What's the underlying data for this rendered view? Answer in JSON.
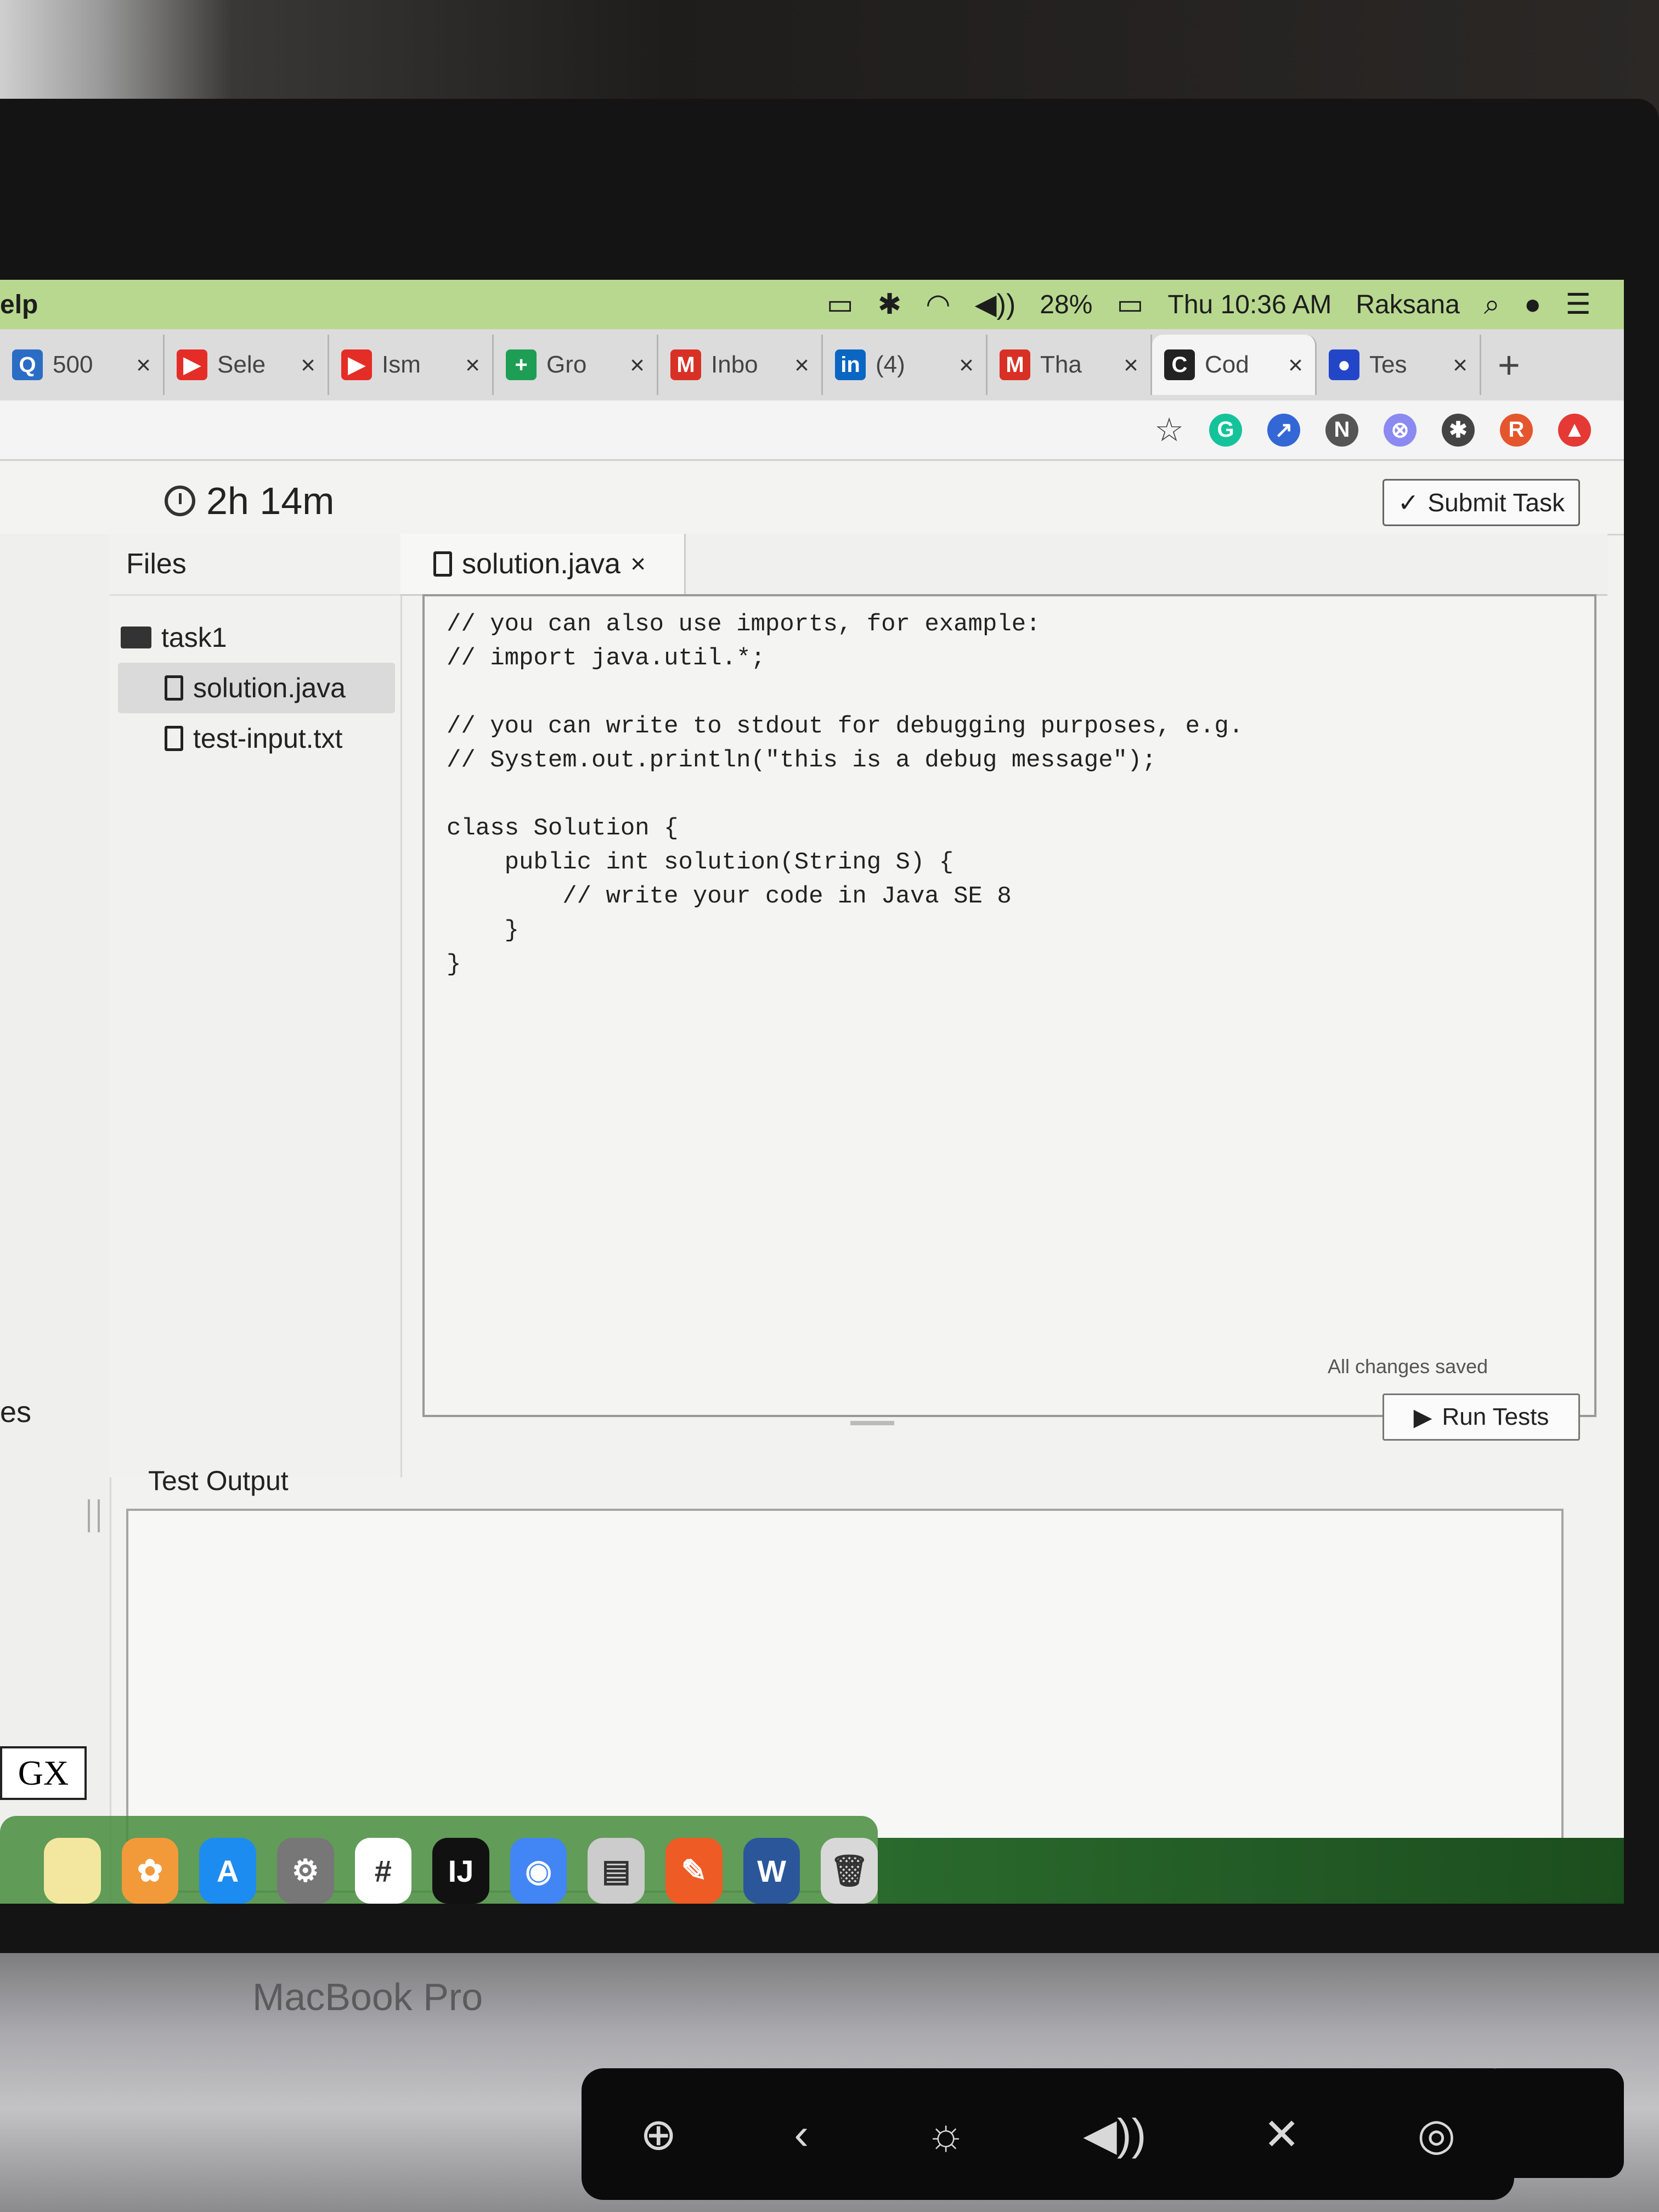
{
  "menubar": {
    "app_menu": "elp",
    "battery": "28%",
    "datetime": "Thu 10:36 AM",
    "user": "Raksana"
  },
  "tabs": [
    {
      "title": "500",
      "icon": "quora-icon",
      "color": "#2b6dc4",
      "glyph": "Q"
    },
    {
      "title": "Sele",
      "icon": "youtube-icon",
      "color": "#e52d27",
      "glyph": "▶"
    },
    {
      "title": "Ism",
      "icon": "youtube-icon",
      "color": "#e52d27",
      "glyph": "▶"
    },
    {
      "title": "Gro",
      "icon": "google-sheets-icon",
      "color": "#1e9e55",
      "glyph": "+"
    },
    {
      "title": "Inbo",
      "icon": "gmail-icon",
      "color": "#d93025",
      "glyph": "M"
    },
    {
      "title": "(4)",
      "icon": "linkedin-icon",
      "color": "#0a66c2",
      "glyph": "in"
    },
    {
      "title": "Tha",
      "icon": "gmail-icon",
      "color": "#d93025",
      "glyph": "M"
    },
    {
      "title": "Cod",
      "icon": "codility-icon",
      "color": "#222222",
      "glyph": "C",
      "active": true
    },
    {
      "title": "Tes",
      "icon": "chat-icon",
      "color": "#2346c9",
      "glyph": "●"
    }
  ],
  "toolbar": {
    "extensions": [
      {
        "icon": "grammarly-icon",
        "color": "#15c39a",
        "glyph": "G"
      },
      {
        "icon": "share-icon",
        "color": "#3367d6",
        "glyph": "↗"
      },
      {
        "icon": "new-badge-icon",
        "color": "#555555",
        "glyph": "N"
      },
      {
        "icon": "blocker-icon",
        "color": "#8a8af0",
        "glyph": "⊗"
      },
      {
        "icon": "puzzle-icon",
        "color": "#444444",
        "glyph": "✱"
      },
      {
        "icon": "profile-avatar",
        "color": "#e4562e",
        "glyph": "R"
      },
      {
        "icon": "upload-icon",
        "color": "#e53935",
        "glyph": "▲"
      }
    ]
  },
  "header": {
    "timer": "2h 14m",
    "submit_label": "Submit Task"
  },
  "left_strip": {
    "partial_label": "es",
    "gx_label": "GX"
  },
  "files_panel": {
    "title": "Files",
    "folder": "task1",
    "files": [
      "solution.java",
      "test-input.txt"
    ]
  },
  "editor": {
    "tab_label": "solution.java",
    "code": "// you can also use imports, for example:\n// import java.util.*;\n\n// you can write to stdout for debugging purposes, e.g.\n// System.out.println(\"this is a debug message\");\n\nclass Solution {\n    public int solution(String S) {\n        // write your code in Java SE 8\n    }\n}",
    "save_status": "All changes saved",
    "run_label": "Run Tests"
  },
  "output": {
    "title": "Test Output"
  },
  "dock": [
    {
      "icon": "notes-icon",
      "color": "#f3e7a0",
      "glyph": ""
    },
    {
      "icon": "photos-icon",
      "color": "#f29a3a",
      "glyph": "✿"
    },
    {
      "icon": "app-store-icon",
      "color": "#1d8cf0",
      "glyph": "A"
    },
    {
      "icon": "system-preferences-icon",
      "color": "#777777",
      "glyph": "⚙"
    },
    {
      "icon": "slack-icon",
      "color": "#ffffff",
      "glyph": "#"
    },
    {
      "icon": "intellij-icon",
      "color": "#111111",
      "glyph": "IJ"
    },
    {
      "icon": "chrome-icon",
      "color": "#4285f4",
      "glyph": "◉"
    },
    {
      "icon": "database-icon",
      "color": "#cccccc",
      "glyph": "▤"
    },
    {
      "icon": "postman-icon",
      "color": "#ef5b25",
      "glyph": "✎"
    },
    {
      "icon": "word-icon",
      "color": "#2b579a",
      "glyph": "W"
    },
    {
      "icon": "trash-icon",
      "color": "#d8d8d8",
      "glyph": "🗑"
    }
  ],
  "device": {
    "label": "MacBook Pro"
  }
}
